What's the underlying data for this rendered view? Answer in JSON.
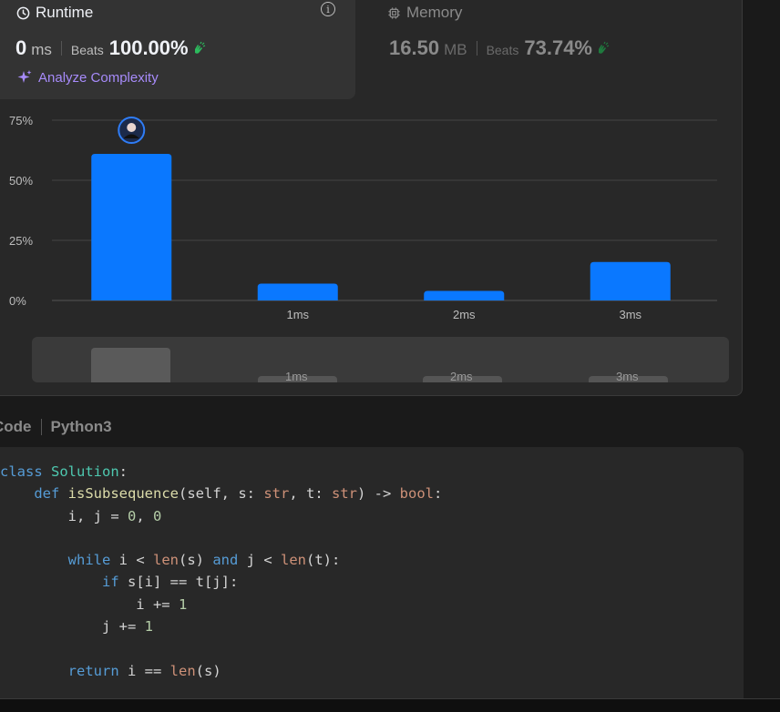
{
  "runtime": {
    "title": "Runtime",
    "value": "0",
    "unit": "ms",
    "beats_label": "Beats",
    "beats_pct": "100.00%",
    "info_icon": "info-icon",
    "clock_icon": "clock-icon"
  },
  "memory": {
    "title": "Memory",
    "value": "16.50",
    "unit": "MB",
    "beats_label": "Beats",
    "beats_pct": "73.74%",
    "chip_icon": "chip-icon"
  },
  "analyze": {
    "label": "Analyze Complexity",
    "icon": "sparkle-icon"
  },
  "chart_data": {
    "type": "bar",
    "categories": [
      "",
      "1ms",
      "2ms",
      "3ms"
    ],
    "values": [
      61,
      7,
      4,
      16
    ],
    "ylim": [
      0,
      75
    ],
    "yticks": [
      "0%",
      "25%",
      "50%",
      "75%"
    ],
    "ytick_values": [
      0,
      25,
      50,
      75
    ],
    "grid": true,
    "bar_color": "#0a78ff",
    "marker_on_category": 0
  },
  "mini_chart": {
    "labels": [
      "1ms",
      "2ms",
      "3ms"
    ]
  },
  "code_header": {
    "tab_label": "Code",
    "language": "Python3"
  },
  "code_lines": [
    "class Solution:",
    "    def isSubsequence(self, s: str, t: str) -> bool:",
    "        i, j = 0, 0",
    "",
    "        while i < len(s) and j < len(t):",
    "            if s[i] == t[j]:",
    "                i += 1",
    "            j += 1",
    "",
    "        return i == len(s)"
  ],
  "colors": {
    "accent": "#0a78ff",
    "success": "#2cbb5d",
    "purple": "#a78bfa"
  }
}
